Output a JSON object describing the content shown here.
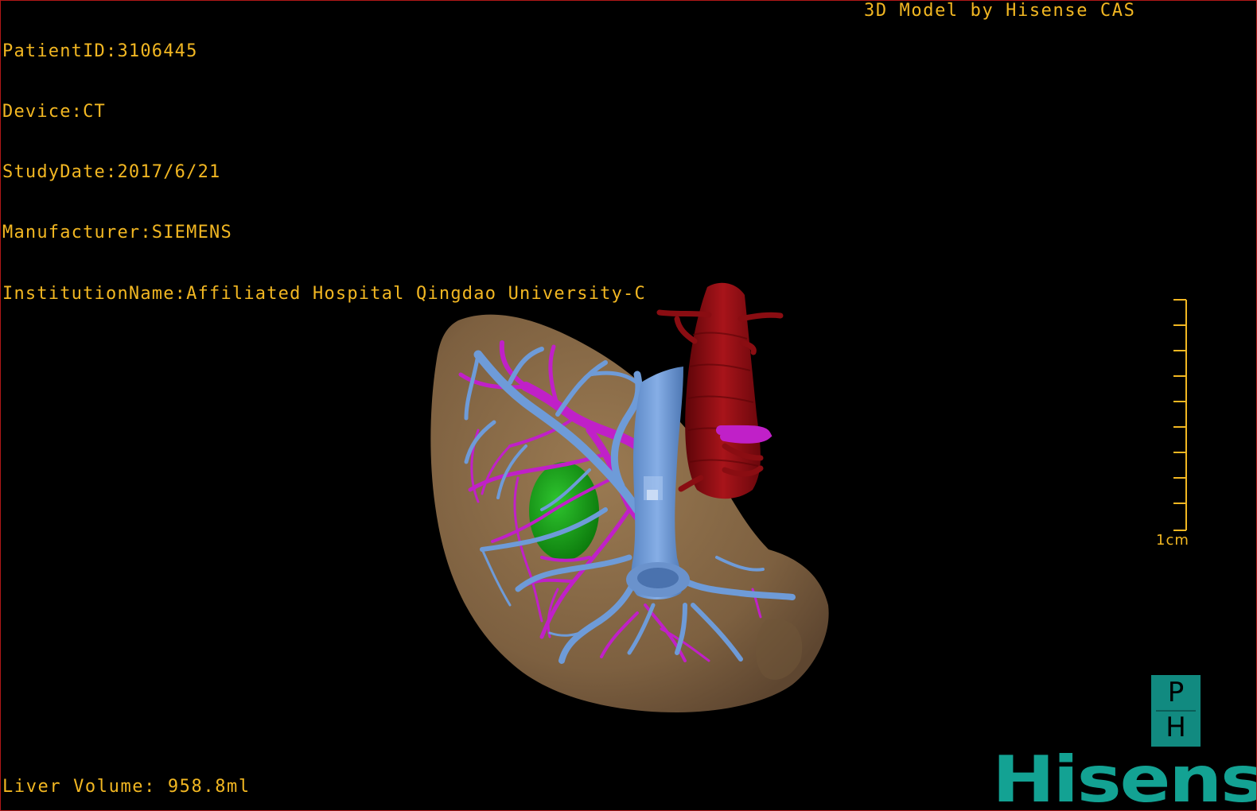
{
  "header": {
    "patient_id": "PatientID:3106445",
    "device": "Device:CT",
    "study_date": "StudyDate:2017/6/21",
    "manufacturer": "Manufacturer:SIEMENS",
    "institution": "InstitutionName:Affiliated Hospital Qingdao University-C"
  },
  "credit": "3D Model by Hisense CAS",
  "liver_volume": "Liver Volume: 958.8ml",
  "scale": {
    "label": "1cm"
  },
  "logo": {
    "letter_top": "P",
    "letter_bottom": "H",
    "wordmark": "Hisense"
  },
  "colors": {
    "overlay_text": "#f2b722",
    "border": "#b01818",
    "liver": "#8a6a46",
    "portal_vein": "#6e9bd8",
    "hepatic_artery": "#c020c8",
    "aorta": "#8a0d12",
    "lesion": "#1a9a1a",
    "brand": "#13a293"
  },
  "icons": {
    "ph": "ph-logo-icon",
    "wordmark": "hisense-wordmark"
  }
}
